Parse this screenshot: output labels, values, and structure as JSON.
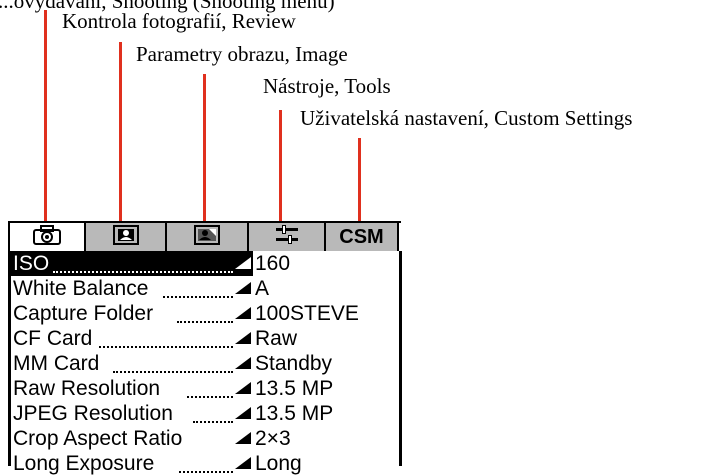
{
  "callouts": {
    "top": "...ovydávání, Shooting (Shooting menu)",
    "review": "Kontrola fotografií, Review",
    "image": "Parametry obrazu, Image",
    "tools": "Nástroje, Tools",
    "custom": "Uživatelská nastavení, Custom Settings"
  },
  "tabs": [
    {
      "icon": "camera-icon",
      "glyph": "📷",
      "active": true
    },
    {
      "icon": "review-icon",
      "glyph": "▣",
      "active": false
    },
    {
      "icon": "image-icon",
      "glyph": "▨",
      "active": false
    },
    {
      "icon": "tools-icon",
      "glyph": "⚙",
      "active": false
    },
    {
      "label": "CSM",
      "active": false
    }
  ],
  "menu": {
    "items": [
      {
        "label": "ISO",
        "value": "160",
        "selected": true
      },
      {
        "label": "White Balance",
        "value": "A"
      },
      {
        "label": "Capture Folder",
        "value": "100STEVE"
      },
      {
        "label": "CF Card",
        "value": "Raw"
      },
      {
        "label": "MM Card",
        "value": "Standby"
      },
      {
        "label": "Raw Resolution",
        "value": "13.5 MP"
      },
      {
        "label": "JPEG Resolution",
        "value": "13.5 MP"
      },
      {
        "label": "Crop Aspect Ratio",
        "value": "2×3"
      },
      {
        "label": "Long Exposure",
        "value": "Long"
      }
    ]
  }
}
